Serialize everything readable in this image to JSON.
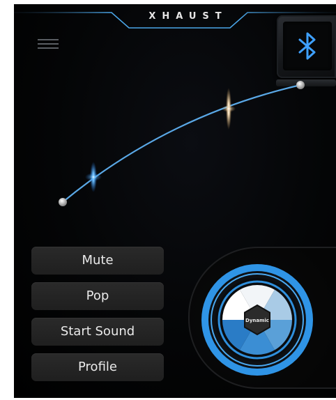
{
  "header": {
    "brand": "XHAUST",
    "menu_icon": "hamburger-menu-icon",
    "bluetooth_icon": "bluetooth-icon"
  },
  "colors": {
    "accent_blue": "#3ea0ff",
    "curve_line": "#5aa8e6",
    "background": "#000000",
    "button_bg": "#252525",
    "button_text": "#eaeaea"
  },
  "buttons": {
    "mute": "Mute",
    "pop": "Pop",
    "start_sound": "Start Sound",
    "profile": "Profile"
  },
  "dial": {
    "mode_label": "Dynamic"
  }
}
